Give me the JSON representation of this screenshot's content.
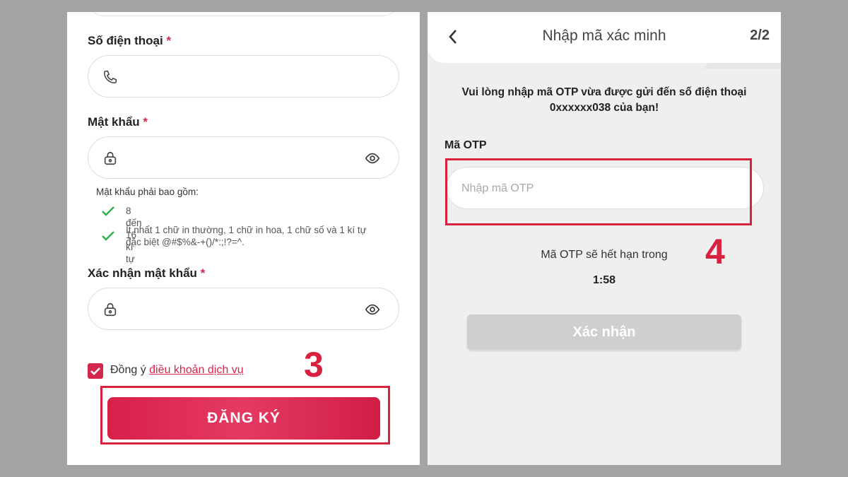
{
  "left": {
    "phone": {
      "label": "Số điện thoại",
      "required": "*"
    },
    "password": {
      "label": "Mật khẩu",
      "required": "*"
    },
    "rules": {
      "title": "Mật khẩu phải bao gồm:",
      "items": [
        {
          "line1": "8 đến 16 kí tự",
          "line2": ""
        },
        {
          "line1": "Ít nhất 1 chữ in thường, 1 chữ in hoa, 1 chữ số và 1 kí tự",
          "line2": "đặc biệt @#$%&-+()/*:;!?=^."
        }
      ]
    },
    "confirm": {
      "label": "Xác nhận mật khẩu",
      "required": "*"
    },
    "agree": {
      "prefix": "Đồng ý",
      "link": "điều khoản dịch vụ",
      "checked": true
    },
    "step_marker": "3",
    "register_button": "ĐĂNG KÝ"
  },
  "right": {
    "header": {
      "title": "Nhập mã xác minh",
      "step": "2/2"
    },
    "message_line1": "Vui lòng nhập mã OTP vừa được gửi đến số điện thoại",
    "message_line2": "0xxxxxx038 của bạn!",
    "otp_label": "Mã OTP",
    "otp_placeholder": "Nhập mã OTP",
    "step_marker": "4",
    "expire_text": "Mã OTP sẽ hết hạn trong",
    "timer": "1:58",
    "confirm_button": "Xác nhận"
  },
  "colors": {
    "accent": "#d3284b",
    "highlight": "#d8213f",
    "check": "#2bb24c",
    "disabled_button": "#cfcfcf"
  }
}
